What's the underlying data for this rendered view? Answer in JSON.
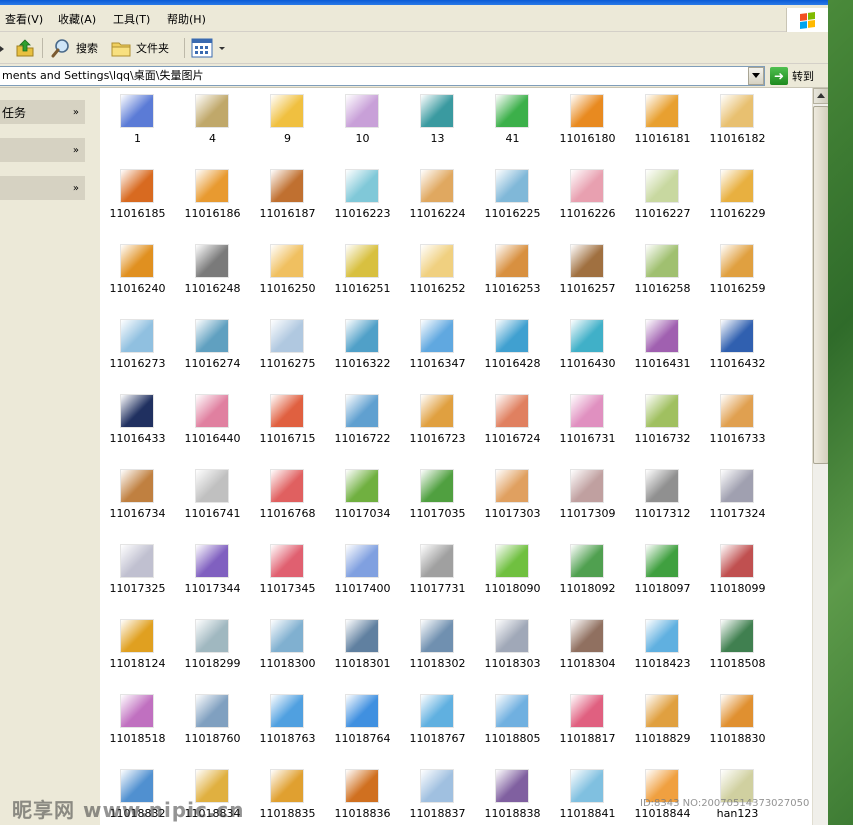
{
  "menu": {
    "items": [
      "查看(V)",
      "收藏(A)",
      "工具(T)",
      "帮助(H)"
    ]
  },
  "toolbar": {
    "search_label": "搜索",
    "folders_label": "文件夹"
  },
  "address": {
    "path": "ments and Settings\\lqq\\桌面\\失量图片",
    "go_label": "转到"
  },
  "taskpane": {
    "sections": [
      "任务",
      "",
      ""
    ]
  },
  "files": [
    {
      "name": "1",
      "thumb": "#5b7bd6"
    },
    {
      "name": "4",
      "thumb": "#c0a86a"
    },
    {
      "name": "9",
      "thumb": "#f0c040"
    },
    {
      "name": "10",
      "thumb": "#c8a0d8"
    },
    {
      "name": "13",
      "thumb": "#3a9aa0"
    },
    {
      "name": "41",
      "thumb": "#3cb04a"
    },
    {
      "name": "11016180",
      "thumb": "#e88a20"
    },
    {
      "name": "11016181",
      "thumb": "#e8a030"
    },
    {
      "name": "11016182",
      "thumb": "#e8c070"
    },
    {
      "name": "11016185",
      "thumb": "#d86a20"
    },
    {
      "name": "11016186",
      "thumb": "#e89a30"
    },
    {
      "name": "11016187",
      "thumb": "#c07030"
    },
    {
      "name": "11016223",
      "thumb": "#80c8d8"
    },
    {
      "name": "11016224",
      "thumb": "#e0a860"
    },
    {
      "name": "11016225",
      "thumb": "#80b8d8"
    },
    {
      "name": "11016226",
      "thumb": "#e8a0b0"
    },
    {
      "name": "11016227",
      "thumb": "#c8d8a0"
    },
    {
      "name": "11016229",
      "thumb": "#e8b040"
    },
    {
      "name": "11016240",
      "thumb": "#e09020"
    },
    {
      "name": "11016248",
      "thumb": "#7a7a7a"
    },
    {
      "name": "11016250",
      "thumb": "#f0c060"
    },
    {
      "name": "11016251",
      "thumb": "#d8c040"
    },
    {
      "name": "11016252",
      "thumb": "#f0d080"
    },
    {
      "name": "11016253",
      "thumb": "#d89040"
    },
    {
      "name": "11016257",
      "thumb": "#a07040"
    },
    {
      "name": "11016258",
      "thumb": "#a0c070"
    },
    {
      "name": "11016259",
      "thumb": "#e0a040"
    },
    {
      "name": "11016273",
      "thumb": "#90c0e0"
    },
    {
      "name": "11016274",
      "thumb": "#60a0c0"
    },
    {
      "name": "11016275",
      "thumb": "#b0c8e0"
    },
    {
      "name": "11016322",
      "thumb": "#50a0c8"
    },
    {
      "name": "11016347",
      "thumb": "#60a8e0"
    },
    {
      "name": "11016428",
      "thumb": "#40a0d0"
    },
    {
      "name": "11016430",
      "thumb": "#40b0c8"
    },
    {
      "name": "11016431",
      "thumb": "#a060b0"
    },
    {
      "name": "11016432",
      "thumb": "#3060b0"
    },
    {
      "name": "11016433",
      "thumb": "#203060"
    },
    {
      "name": "11016440",
      "thumb": "#e080a0"
    },
    {
      "name": "11016715",
      "thumb": "#e06040"
    },
    {
      "name": "11016722",
      "thumb": "#60a0d0"
    },
    {
      "name": "11016723",
      "thumb": "#e0a040"
    },
    {
      "name": "11016724",
      "thumb": "#e08060"
    },
    {
      "name": "11016731",
      "thumb": "#e090c0"
    },
    {
      "name": "11016732",
      "thumb": "#a0c060"
    },
    {
      "name": "11016733",
      "thumb": "#e0a050"
    },
    {
      "name": "11016734",
      "thumb": "#c08040"
    },
    {
      "name": "11016741",
      "thumb": "#c0c0c0"
    },
    {
      "name": "11016768",
      "thumb": "#e06060"
    },
    {
      "name": "11017034",
      "thumb": "#70b040"
    },
    {
      "name": "11017035",
      "thumb": "#50a040"
    },
    {
      "name": "11017303",
      "thumb": "#e0a060"
    },
    {
      "name": "11017309",
      "thumb": "#c0a0a0"
    },
    {
      "name": "11017312",
      "thumb": "#909090"
    },
    {
      "name": "11017324",
      "thumb": "#a0a0b0"
    },
    {
      "name": "11017325",
      "thumb": "#c0c0d0"
    },
    {
      "name": "11017344",
      "thumb": "#8060c0"
    },
    {
      "name": "11017345",
      "thumb": "#e06070"
    },
    {
      "name": "11017400",
      "thumb": "#80a0e0"
    },
    {
      "name": "11017731",
      "thumb": "#a0a0a0"
    },
    {
      "name": "11018090",
      "thumb": "#70c040"
    },
    {
      "name": "11018092",
      "thumb": "#50a050"
    },
    {
      "name": "11018097",
      "thumb": "#40a040"
    },
    {
      "name": "11018099",
      "thumb": "#c05050"
    },
    {
      "name": "11018124",
      "thumb": "#e0a020"
    },
    {
      "name": "11018299",
      "thumb": "#a0b8c0"
    },
    {
      "name": "11018300",
      "thumb": "#80b0d0"
    },
    {
      "name": "11018301",
      "thumb": "#6080a0"
    },
    {
      "name": "11018302",
      "thumb": "#7090b0"
    },
    {
      "name": "11018303",
      "thumb": "#a0a8b8"
    },
    {
      "name": "11018304",
      "thumb": "#907060"
    },
    {
      "name": "11018423",
      "thumb": "#60b0e0"
    },
    {
      "name": "11018508",
      "thumb": "#408050"
    },
    {
      "name": "11018518",
      "thumb": "#c070c0"
    },
    {
      "name": "11018760",
      "thumb": "#80a0c0"
    },
    {
      "name": "11018763",
      "thumb": "#50a0e0"
    },
    {
      "name": "11018764",
      "thumb": "#4090e0"
    },
    {
      "name": "11018767",
      "thumb": "#60b0e0"
    },
    {
      "name": "11018805",
      "thumb": "#70b0e0"
    },
    {
      "name": "11018817",
      "thumb": "#e06080"
    },
    {
      "name": "11018829",
      "thumb": "#e0a040"
    },
    {
      "name": "11018830",
      "thumb": "#e09030"
    },
    {
      "name": "11018832",
      "thumb": "#5090d0"
    },
    {
      "name": "11018834",
      "thumb": "#e0b040"
    },
    {
      "name": "11018835",
      "thumb": "#e0a030"
    },
    {
      "name": "11018836",
      "thumb": "#d07020"
    },
    {
      "name": "11018837",
      "thumb": "#a0c0e0"
    },
    {
      "name": "11018838",
      "thumb": "#8060a0"
    },
    {
      "name": "11018841",
      "thumb": "#80c0e0"
    },
    {
      "name": "11018844",
      "thumb": "#f0a040"
    },
    {
      "name": "han123",
      "thumb": "#d0d0a0"
    }
  ],
  "watermark": {
    "text": "昵享网 www.nipic.cn",
    "id_text": "ID:8343 NO:20070514373027050"
  },
  "colors": {
    "window_bg": "#ece9d8",
    "content_bg": "#ffffff",
    "title_blue": "#0a5bd6",
    "go_green": "#2a9a2a"
  }
}
